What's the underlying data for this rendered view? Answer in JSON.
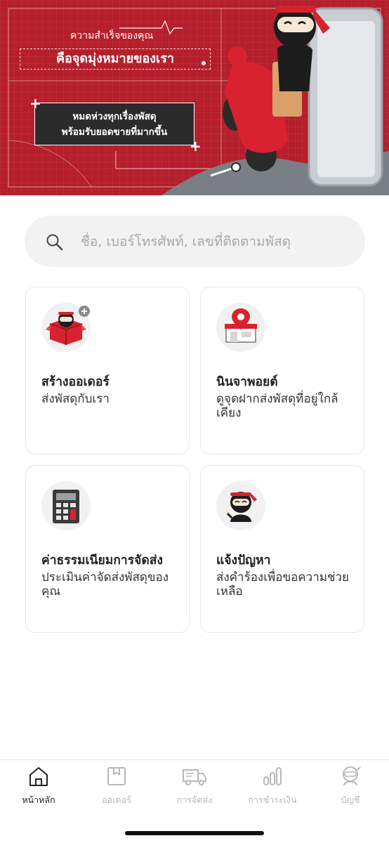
{
  "banner": {
    "line1": "ความสำเร็จของคุณ",
    "line2": "คือจุดมุ่งหมายของเรา",
    "box_line1": "หมดห่วงทุกเรื่องพัสดุ",
    "box_line2": "พร้อมรับยอดขายที่มากขึ้น",
    "bg_color": "#b51e2b"
  },
  "search": {
    "placeholder": "ชื่อ, เบอร์โทรศัพท์, เลขที่ติดตามพัสดุ",
    "icon": "search-icon"
  },
  "cards": [
    {
      "icon": "create-order-icon",
      "title": "สร้างออเดอร์",
      "subtitle": "ส่งพัสดุกับเรา"
    },
    {
      "icon": "location-store-icon",
      "title": "นินจาพอยต์",
      "subtitle": "ดูจุดฝากส่งพัสดุที่อยู่ใกล้เคียง"
    },
    {
      "icon": "calculator-icon",
      "title": "ค่าธรรมเนียมการจัดส่ง",
      "subtitle": "ประเมินค่าจัดส่งพัสดุของคุณ"
    },
    {
      "icon": "ninja-support-icon",
      "title": "แจ้งปัญหา",
      "subtitle": "ส่งคำร้องเพื่อขอความช่วยเหลือ"
    }
  ],
  "nav": [
    {
      "label": "หน้าหลัก",
      "icon": "home-icon",
      "active": true
    },
    {
      "label": "ออเดอร์",
      "icon": "order-box-icon",
      "active": false
    },
    {
      "label": "การจัดส่ง",
      "icon": "truck-icon",
      "active": false
    },
    {
      "label": "การชำระเงิน",
      "icon": "bar-chart-icon",
      "active": false
    },
    {
      "label": "บัญชี",
      "icon": "ninja-account-icon",
      "active": false
    }
  ]
}
